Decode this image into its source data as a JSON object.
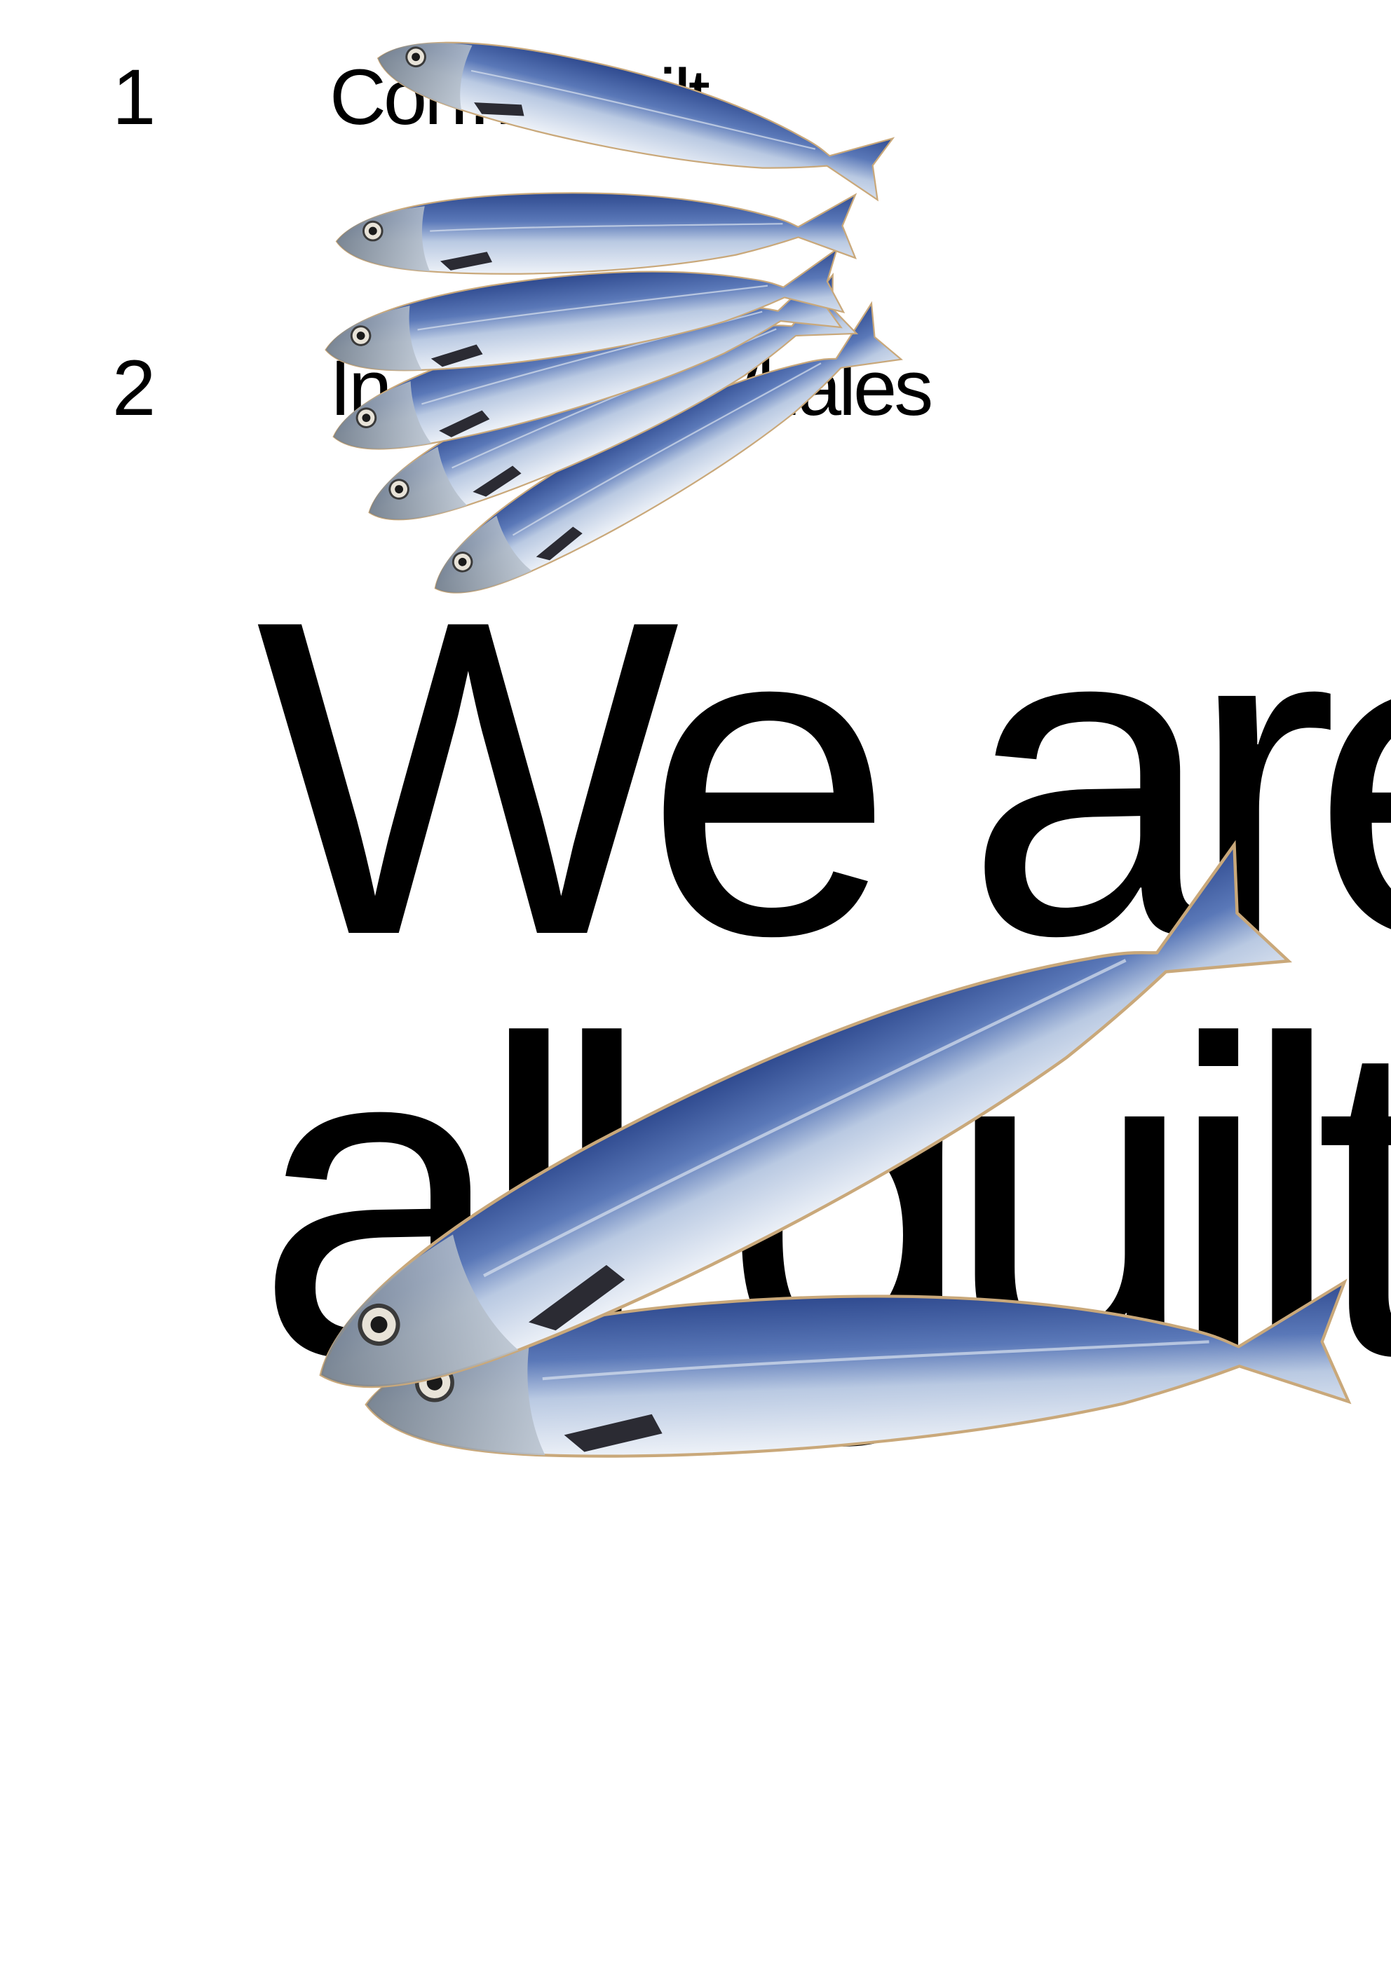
{
  "toc": [
    {
      "number": "1",
      "title": "Con… Guilt"
    },
    {
      "number": "2",
      "title": "In… ourse Whales"
    }
  ],
  "headline": {
    "line1": "We are",
    "line2": "all guilt"
  },
  "images": {
    "fish_fan": "fish-fan-photo",
    "fish_pair": "fish-pair-photo"
  },
  "colors": {
    "background": "#ffffff",
    "text": "#000000",
    "fish_back": "#3d5a9e",
    "fish_belly": "#e8eef6"
  }
}
